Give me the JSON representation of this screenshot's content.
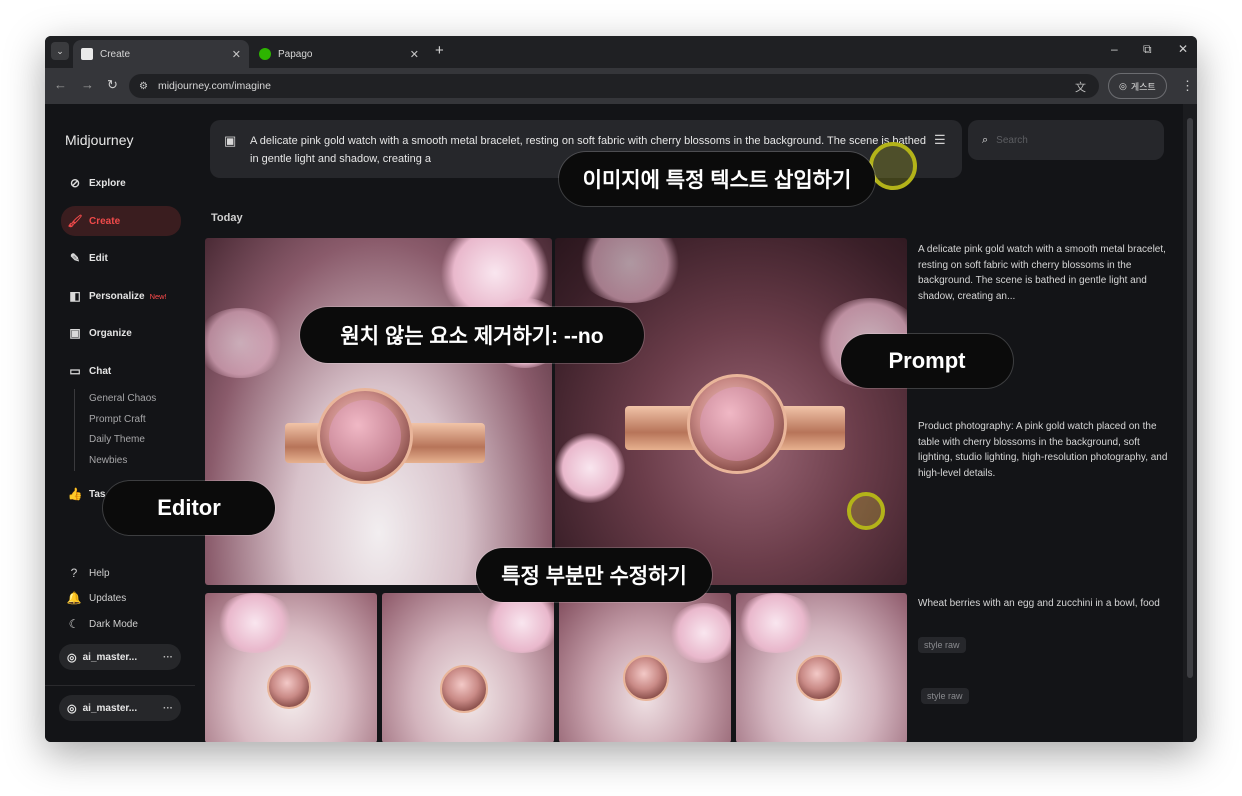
{
  "browser": {
    "tabs": [
      {
        "title": "Create",
        "close": "✕",
        "favicon_color": "#eaeaea"
      },
      {
        "title": "Papago",
        "close": "✕",
        "favicon_color": "#2db400"
      }
    ],
    "tab_dropdown_icon": "chevron-down-icon",
    "new_tab": "+",
    "window_controls": {
      "minimize": "–",
      "restore": "⧉",
      "close": "✕"
    },
    "url": "midjourney.com/imagine",
    "guest_label": "게스트",
    "nav": {
      "back": "←",
      "forward": "→",
      "reload": "↻"
    }
  },
  "sidebar": {
    "brand": "Midjourney",
    "items": [
      {
        "label": "Explore",
        "icon": "compass-icon",
        "glyph": "⊘"
      },
      {
        "label": "Create",
        "icon": "brush-icon",
        "glyph": "🖌"
      },
      {
        "label": "Edit",
        "icon": "edit-icon",
        "glyph": "✎"
      },
      {
        "label": "Personalize",
        "icon": "personalize-icon",
        "glyph": "◧",
        "badge": "New!"
      },
      {
        "label": "Organize",
        "icon": "image-icon",
        "glyph": "▣"
      },
      {
        "label": "Chat",
        "icon": "chat-icon",
        "glyph": "▭"
      },
      {
        "label": "Tas",
        "icon": "thumbs-up-icon",
        "glyph": "👍"
      }
    ],
    "chat_rooms": [
      "General Chaos",
      "Prompt Craft",
      "Daily Theme",
      "Newbies"
    ],
    "footer": [
      {
        "label": "Help",
        "glyph": "?"
      },
      {
        "label": "Updates",
        "glyph": "🔔"
      },
      {
        "label": "Dark Mode",
        "glyph": "☾"
      }
    ],
    "account_name": "ai_master...",
    "account_more": "···"
  },
  "prompt": {
    "text": "A delicate pink gold watch with a smooth metal bracelet, resting on soft fabric with cherry blossoms in the background. The scene is bathed in gentle light and shadow, creating a",
    "settings_icon": "sliders-icon"
  },
  "search": {
    "placeholder": "Search"
  },
  "section_title": "Today",
  "descriptions": [
    "A delicate pink gold watch with a smooth metal bracelet, resting on soft fabric with cherry blossoms in the background. The scene is bathed in gentle light and shadow, creating an...",
    "Product photography: A pink gold watch placed on the table with cherry blossoms in the background, soft lighting, studio lighting, high-resolution photography, and high-level details.",
    "Wheat berries with an egg and zucchini in a bowl, food"
  ],
  "tags": [
    "style raw",
    "style raw"
  ],
  "callouts": {
    "insert_text": "이미지에 특정 텍스트 삽입하기",
    "remove_elements": "원치 않는 요소 제거하기: --no",
    "prompt": "Prompt",
    "editor": "Editor",
    "edit_part": "특정 부분만 수정하기"
  },
  "colors": {
    "accent": "#f04a4a",
    "highlight_ring": "#b3b319",
    "background": "#131417"
  }
}
